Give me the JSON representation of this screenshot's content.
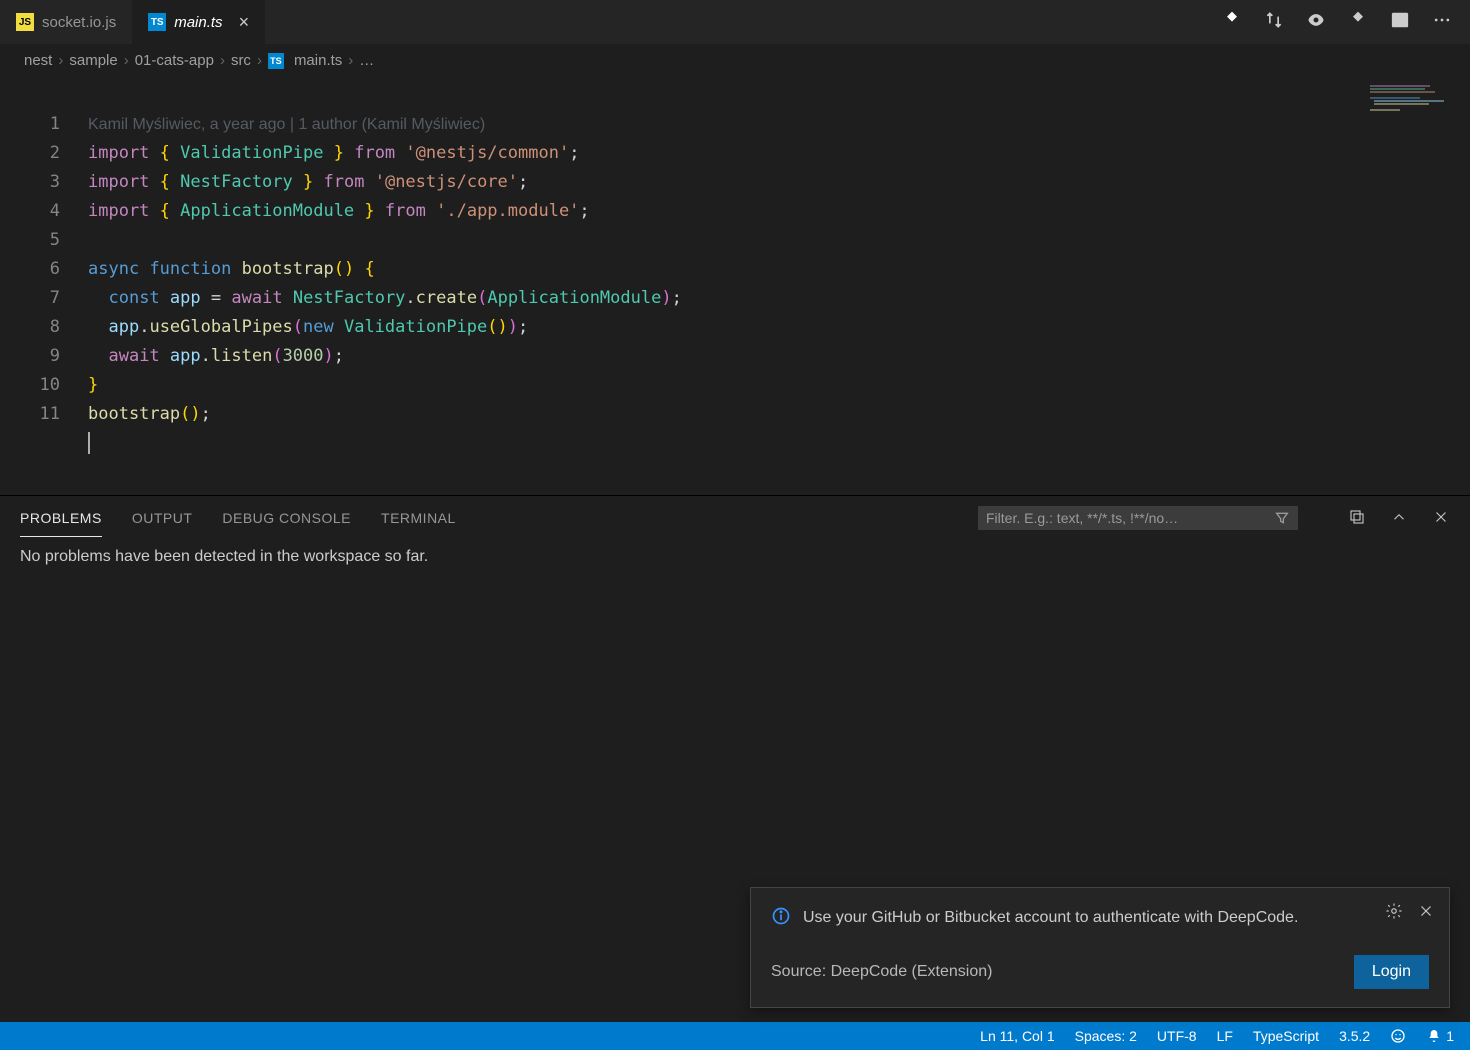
{
  "tabs": [
    {
      "label": "socket.io.js",
      "icon": "js"
    },
    {
      "label": "main.ts",
      "icon": "ts"
    }
  ],
  "breadcrumbs": {
    "parts": [
      "nest",
      "sample",
      "01-cats-app",
      "src"
    ],
    "file": "main.ts",
    "ellipsis": "…"
  },
  "blame": "Kamil Myśliwiec, a year ago | 1 author (Kamil Myśliwiec)",
  "line_numbers": [
    "1",
    "2",
    "3",
    "4",
    "5",
    "6",
    "7",
    "8",
    "9",
    "10",
    "11"
  ],
  "panel": {
    "tabs": {
      "problems": "PROBLEMS",
      "output": "OUTPUT",
      "debug": "DEBUG CONSOLE",
      "terminal": "TERMINAL"
    },
    "filter_placeholder": "Filter. E.g.: text, **/*.ts, !**/no…",
    "message": "No problems have been detected in the workspace so far."
  },
  "notification": {
    "message": "Use your GitHub or Bitbucket account to authenticate with DeepCode.",
    "source": "Source: DeepCode (Extension)",
    "login": "Login"
  },
  "status": {
    "cursor": "Ln 11, Col 1",
    "spaces": "Spaces: 2",
    "encoding": "UTF-8",
    "eol": "LF",
    "language": "TypeScript",
    "ts_version": "3.5.2",
    "bell": "1"
  }
}
